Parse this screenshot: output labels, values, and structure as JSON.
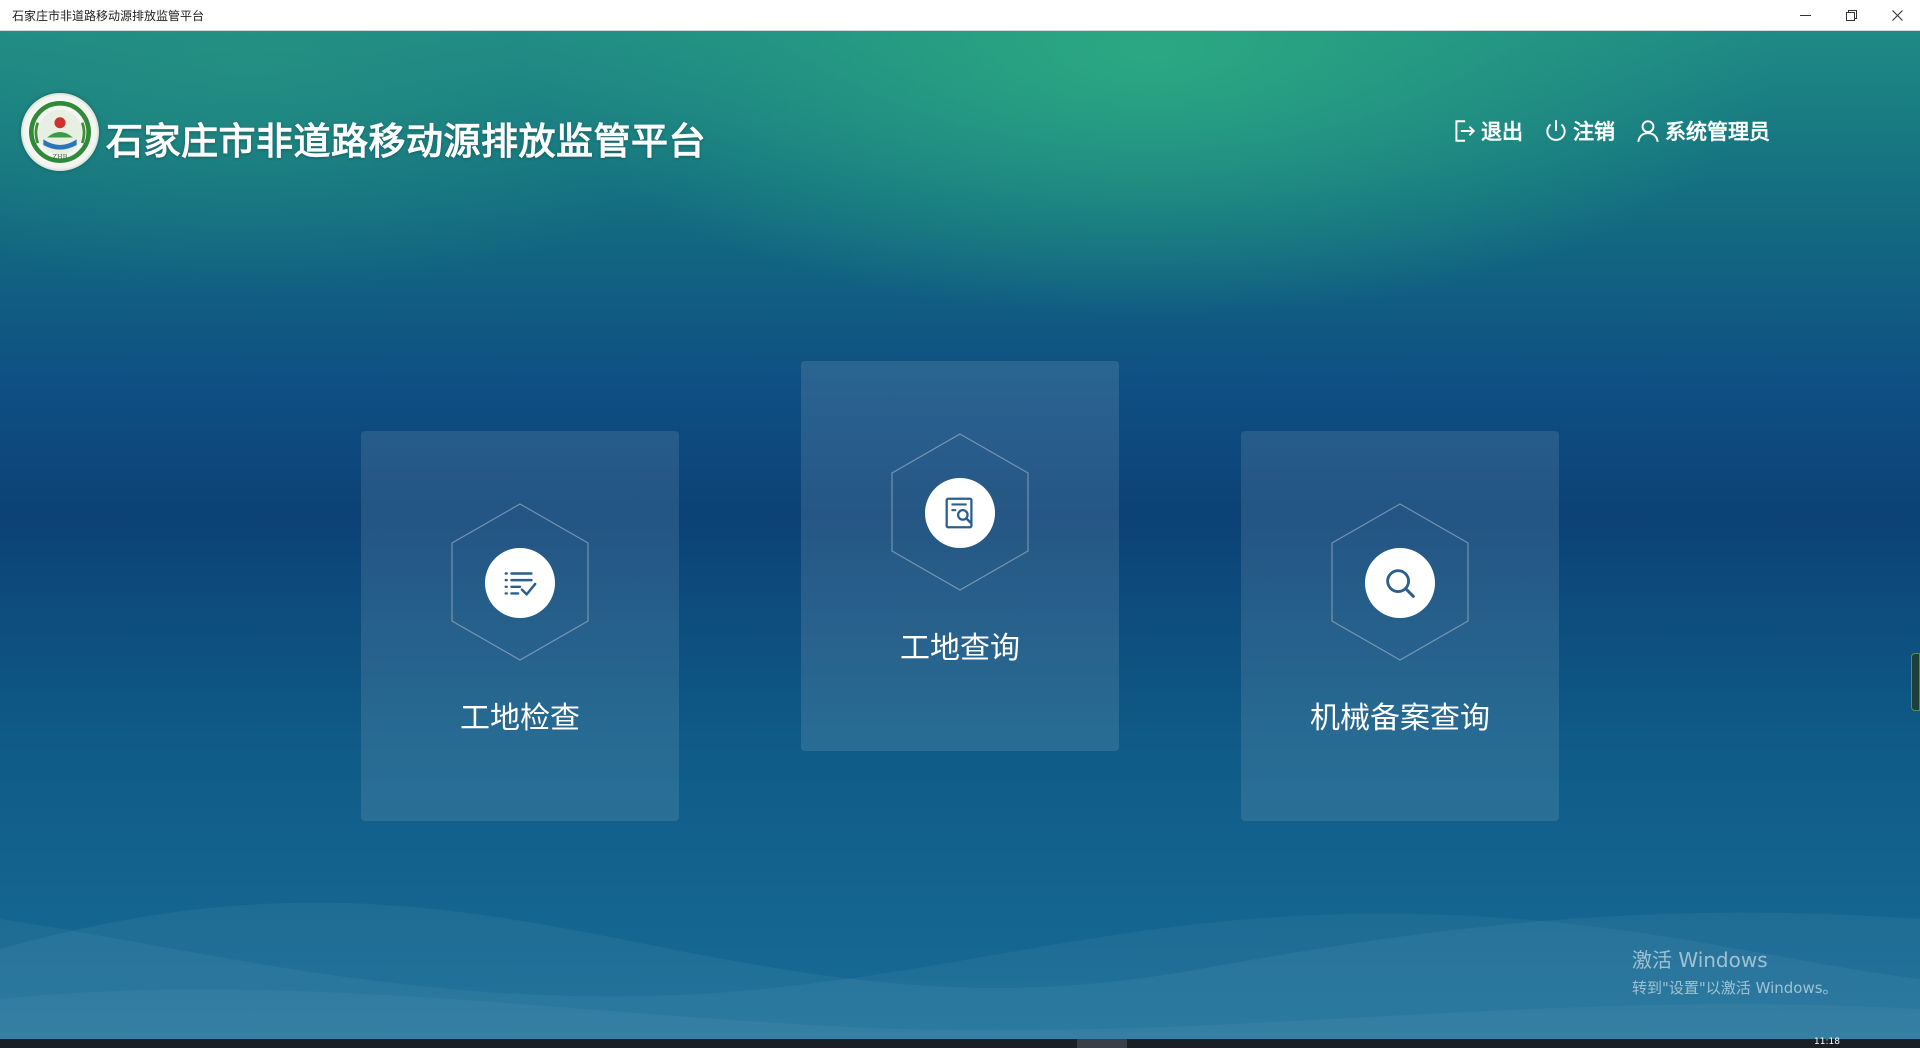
{
  "window": {
    "title": "石家庄市非道路移动源排放监管平台",
    "controls": [
      "minimize-icon",
      "restore-icon",
      "close-icon"
    ]
  },
  "header": {
    "title": "石家庄市非道路移动源排放监管平台",
    "logo_text": "ZHB",
    "actions": {
      "exit": "退出",
      "logout": "注销",
      "user": "系统管理员"
    }
  },
  "cards": {
    "inspect": {
      "label": "工地检查",
      "icon": "checklist-icon"
    },
    "query": {
      "label": "工地查询",
      "icon": "document-search-icon"
    },
    "machine": {
      "label": "机械备案查询",
      "icon": "search-icon"
    }
  },
  "watermark": {
    "line1": "激活 Windows",
    "line2": "转到\"设置\"以激活 Windows。"
  },
  "taskbar": {
    "clock": "11:18"
  },
  "colors": {
    "card_bg": "rgba(255,255,255,0.10)",
    "icon_blue": "#2b5f8e",
    "bg_top": "#1f8a84",
    "bg_mid": "#0c4276",
    "bg_bottom": "#186d97"
  }
}
